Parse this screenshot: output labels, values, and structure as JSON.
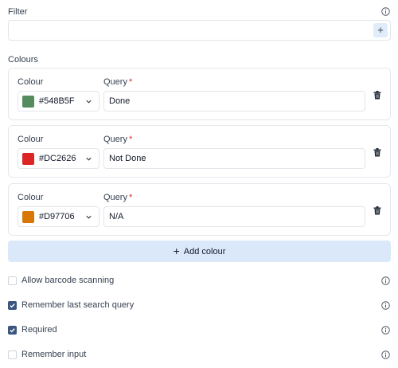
{
  "filter": {
    "label": "Filter",
    "value": "",
    "add_button": "+"
  },
  "colours": {
    "label": "Colours",
    "colour_heading": "Colour",
    "query_heading": "Query",
    "required_mark": "*",
    "rows": [
      {
        "hex": "#548B5F",
        "swatch": "#548B5F",
        "query": "Done"
      },
      {
        "hex": "#DC2626",
        "swatch": "#DC2626",
        "query": "Not Done"
      },
      {
        "hex": "#D97706",
        "swatch": "#D97706",
        "query": "N/A"
      }
    ],
    "add_button": "Add colour"
  },
  "options": [
    {
      "label": "Allow barcode scanning",
      "checked": false
    },
    {
      "label": "Remember last search query",
      "checked": true
    },
    {
      "label": "Required",
      "checked": true
    },
    {
      "label": "Remember input",
      "checked": false
    }
  ],
  "icons": {
    "info": "info-circle-icon",
    "trash": "trash-icon",
    "chevron": "chevron-down-icon",
    "check": "check-icon"
  },
  "colors": {
    "accent": "#3a5680",
    "button_bg": "#dbe8f9"
  }
}
